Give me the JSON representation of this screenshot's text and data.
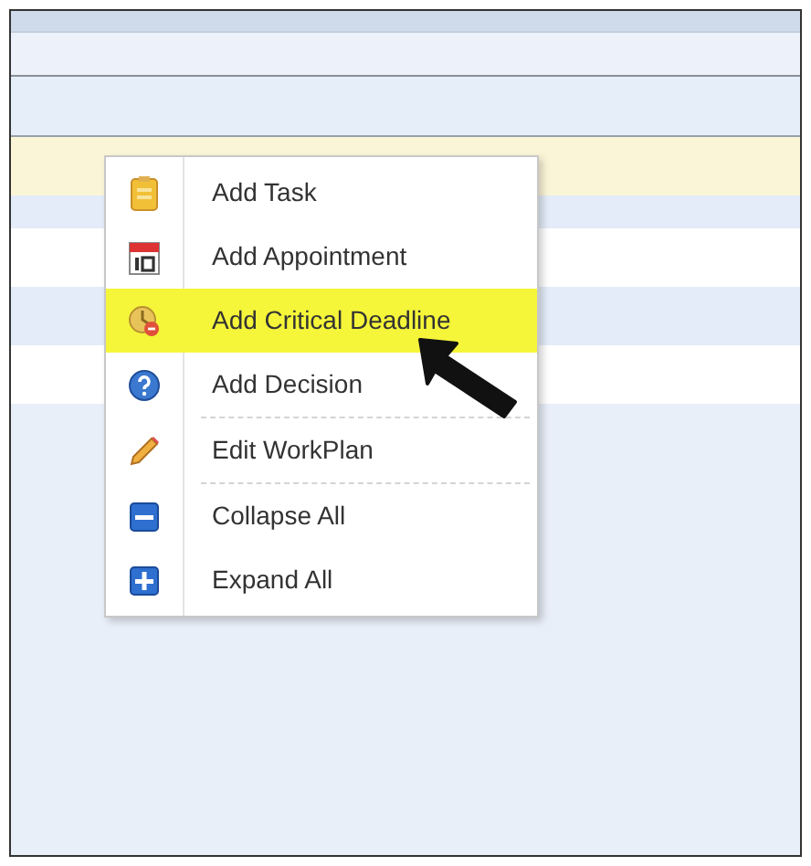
{
  "menu": {
    "items": [
      {
        "label": "Add Task",
        "selected": false,
        "separator_after": false
      },
      {
        "label": "Add Appointment",
        "selected": false,
        "separator_after": false
      },
      {
        "label": "Add Critical Deadline",
        "selected": true,
        "separator_after": false
      },
      {
        "label": "Add Decision",
        "selected": false,
        "separator_after": true
      },
      {
        "label": "Edit WorkPlan",
        "selected": false,
        "separator_after": true
      },
      {
        "label": "Collapse All",
        "selected": false,
        "separator_after": false
      },
      {
        "label": "Expand All",
        "selected": false,
        "separator_after": false
      }
    ]
  }
}
